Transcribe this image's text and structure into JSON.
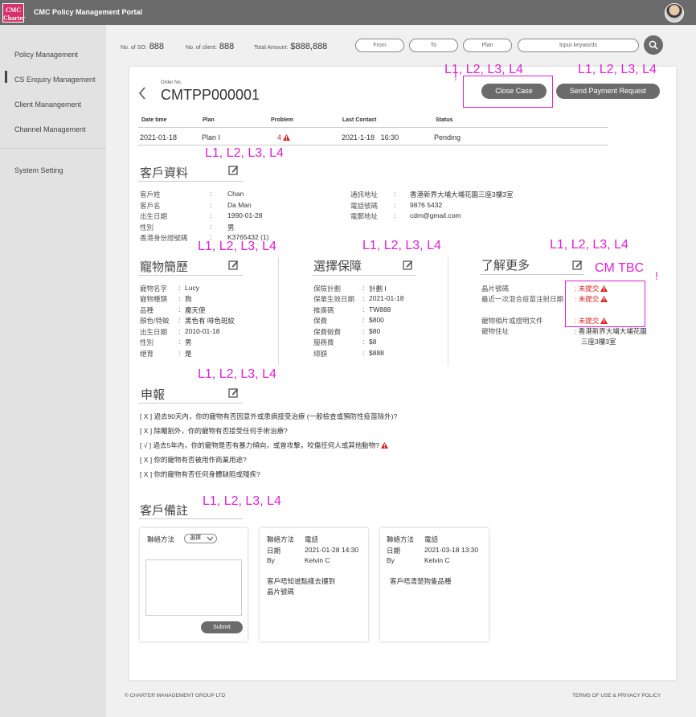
{
  "header": {
    "logo_text": "CMC Charter",
    "title": "CMC Policy Management Portal"
  },
  "sidebar": {
    "items": [
      {
        "label": "Policy Management"
      },
      {
        "label": "CS Enquiry Management"
      },
      {
        "label": "Client Manangement"
      },
      {
        "label": "Channel Management"
      },
      {
        "label": "System Setting"
      }
    ]
  },
  "stats": {
    "so_label": "No. of SO:",
    "so_value": "888",
    "client_label": "No. of client:",
    "client_value": "888",
    "amount_label": "Total Amount:",
    "amount_value": "$888,888"
  },
  "filters": {
    "from": "From",
    "to": "To",
    "plan": "Plan",
    "keywords": "Input keywords"
  },
  "order": {
    "label": "Order No.",
    "number": "CMTPP000001",
    "close_case": "Close Case",
    "send_payment": "Send Payment Request"
  },
  "table": {
    "headers": [
      "Date time",
      "Plan",
      "Problem",
      "Last Contact",
      "Status"
    ],
    "row": {
      "date": "2021-01-18",
      "plan": "Plan I",
      "problem": "4",
      "last_contact": "2021-1-18",
      "time": "16:30",
      "status": "Pending"
    }
  },
  "annotations": {
    "levels": "L1, L2, L3, L4",
    "cm_tbc": "CM TBC",
    "excl": "!"
  },
  "customer": {
    "title": "客戶資料",
    "left": [
      {
        "label": "客戶姓",
        "value": "Chan"
      },
      {
        "label": "客戶名",
        "value": "Da Man"
      },
      {
        "label": "出生日期",
        "value": "1990-01-28"
      },
      {
        "label": "性別",
        "value": "男"
      },
      {
        "label": "香港身份證號碼",
        "value": "K3765432 (1)"
      }
    ],
    "right": [
      {
        "label": "通訊地址",
        "value": "香港新界大埔大埔花園三座3樓3室"
      },
      {
        "label": "電話號碼",
        "value": "9876 5432"
      },
      {
        "label": "電郵地址",
        "value": "cdm@gmail.com"
      }
    ]
  },
  "pet": {
    "title": "寵物簡歷",
    "rows": [
      {
        "label": "寵物名字",
        "value": "Lucy"
      },
      {
        "label": "寵物種類",
        "value": "狗"
      },
      {
        "label": "品種",
        "value": "魔天使"
      },
      {
        "label": "顏色/特徵",
        "value": "黑色有 啡色斑紋"
      },
      {
        "label": "出生日期",
        "value": "2010-01-18"
      },
      {
        "label": "性別",
        "value": "男"
      },
      {
        "label": "絕育",
        "value": "是"
      }
    ]
  },
  "plan": {
    "title": "選擇保障",
    "rows": [
      {
        "label": "保險計劃",
        "value": "計劃 I"
      },
      {
        "label": "保單生效日期",
        "value": "2021-01-18"
      },
      {
        "label": "推廣碼",
        "value": "TW888"
      },
      {
        "label": "保費",
        "value": "$800"
      },
      {
        "label": "保費徵費",
        "value": "$80"
      },
      {
        "label": "服務費",
        "value": "$8"
      },
      {
        "label": "總額",
        "value": "$888"
      }
    ]
  },
  "more": {
    "title": "了解更多",
    "rows": [
      {
        "label": "晶片號碼",
        "value": "未提交"
      },
      {
        "label": "最近一次混合疫苗注射日期",
        "value": "未提交"
      },
      {
        "label": "寵物相片或證明文件",
        "value": "未提交"
      },
      {
        "label": "寵物住址",
        "value": "香港新界大埔大埔花園",
        "value2": "三座3樓3室"
      }
    ]
  },
  "declaration": {
    "title": "申報",
    "items": [
      "[ X ] 過去90天內，你的寵物有否因意外或患病接受治療 (一般檢查或預防性疫苗除外)?",
      "[ X ] 除閹割外，你的寵物有否接受任何手術治療?",
      "[ √ ] 過去5年內，你的寵物是否有暴力傾向，或曾攻擊，咬傷任何人或其他動物?",
      "[ X ] 你的寵物有否被用作商業用途?",
      "[ X ] 你的寵物有否任何身體缺陷或殘疾?"
    ]
  },
  "notes": {
    "title": "客戶備註",
    "form": {
      "method_label": "聯絡方法",
      "select_value": "選擇",
      "submit": "Submit"
    },
    "cards": [
      {
        "method_label": "聯絡方法",
        "method": "電話",
        "date_label": "日期",
        "date": "2021-01-28 14:30",
        "by_label": "By",
        "by": "Kelvin C",
        "text1": "客戶唔知道點樣去攞到",
        "text2": "晶片號碼"
      },
      {
        "method_label": "聯絡方法",
        "method": "電話",
        "date_label": "日期",
        "date": "2021-03-18 13:30",
        "by_label": "By",
        "by": "Kelvin C",
        "text1": "客戶唔清楚狗隻品種",
        "text2": ""
      }
    ]
  },
  "footer": {
    "copyright": "© CHARTER MANAGEMENT GROUP LTD",
    "terms": "TERMS OF USE & PRIVACY POLICY"
  },
  "colors": {
    "annotation": "#e01fd6",
    "warning": "#e02020",
    "topbar": "#6b6b6b"
  }
}
